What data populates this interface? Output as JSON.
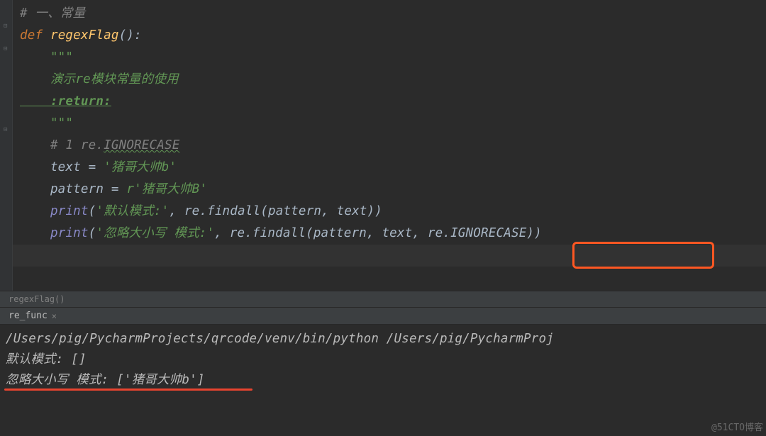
{
  "editor": {
    "lines": {
      "l1": {
        "comment": "# 一、常量"
      },
      "l2": {
        "kw": "def ",
        "fn": "regexFlag",
        "paren": "():"
      },
      "l3": {
        "doc": "    \"\"\""
      },
      "l4": {
        "doc": "    演示re模块常量的使用"
      },
      "l5": {
        "doc": "    :return:"
      },
      "l6": {
        "doc": "    \"\"\""
      },
      "l7": {
        "comment": "    # 1 re.",
        "comment_wavy": "IGNORECASE"
      },
      "l8": {
        "t1": "    text ",
        "op": "= ",
        "str": "'猪哥大帅b'"
      },
      "l9": {
        "t1": "    pattern ",
        "op": "= ",
        "raw": "r",
        "str": "'猪哥大帅B'"
      },
      "l10": {
        "pre": "    ",
        "call": "print",
        "p1": "(",
        "str1": "'默认模式:'",
        "mid": ", re.findall(pattern, text))"
      },
      "l11": {
        "pre": "    ",
        "call": "print",
        "p1": "(",
        "str1": "'忽略大小写 ",
        "str2": "模式:'",
        "mid": ", re.findall(pattern, text, ",
        "flag": "re.IGNORECASE))"
      }
    }
  },
  "breadcrumb": {
    "fn": "regexFlag()"
  },
  "runTab": {
    "label": "re_func"
  },
  "console": {
    "path": "/Users/pig/PycharmProjects/qrcode/venv/bin/python /Users/pig/PycharmProj",
    "out1": "默认模式: []",
    "out2": "忽略大小写 模式: ['猪哥大帅b']"
  },
  "watermark": "@51CTO博客"
}
